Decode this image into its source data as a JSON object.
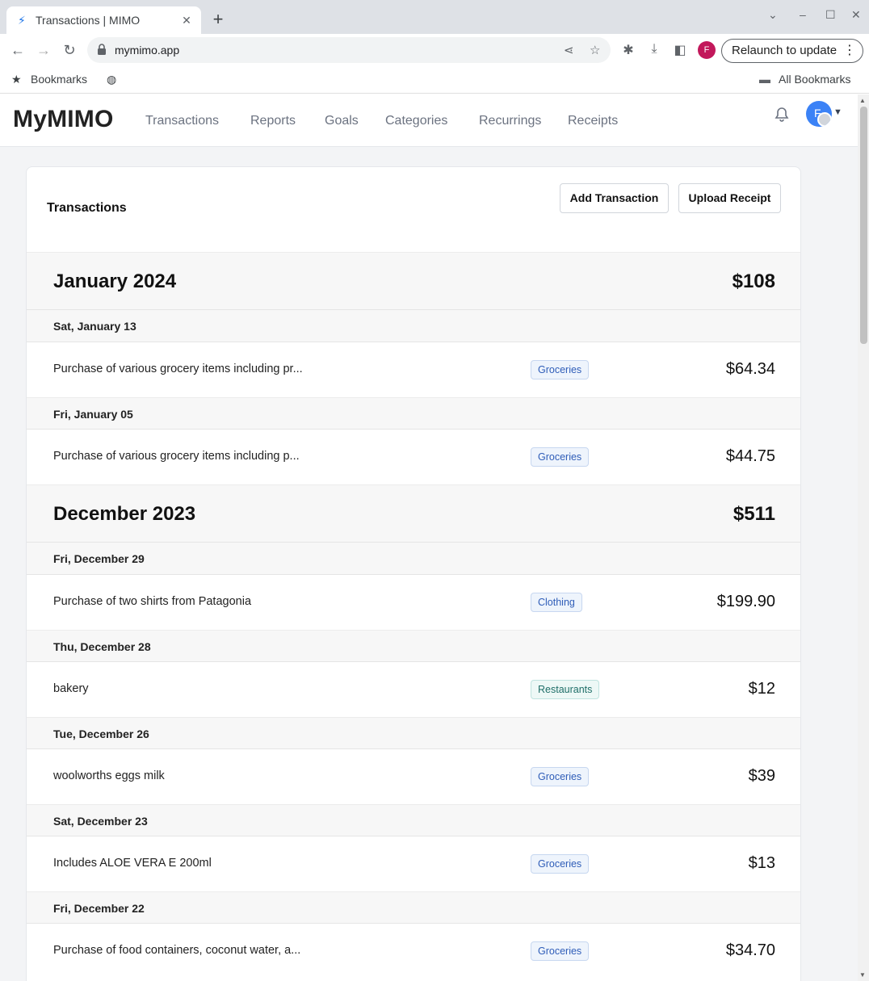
{
  "browser": {
    "tab_title": "Transactions | MIMO",
    "url": "mymimo.app",
    "relaunch_label": "Relaunch to update",
    "profile_initial": "F",
    "bookmarks_label": "Bookmarks",
    "all_bookmarks_label": "All Bookmarks"
  },
  "app": {
    "logo": "MyMIMO",
    "nav": [
      "Transactions",
      "Reports",
      "Goals",
      "Categories",
      "Recurrings",
      "Receipts"
    ],
    "avatar_initial": "F"
  },
  "card": {
    "title": "Transactions",
    "add_button": "Add Transaction",
    "upload_button": "Upload Receipt"
  },
  "months": [
    {
      "name": "January 2024",
      "total": "$108",
      "days": [
        {
          "date": "Sat, January 13",
          "transactions": [
            {
              "description": "Purchase of various grocery items including pr...",
              "category": "Groceries",
              "amount": "$64.34"
            }
          ]
        },
        {
          "date": "Fri, January 05",
          "transactions": [
            {
              "description": "Purchase of various grocery items including p...",
              "category": "Groceries",
              "amount": "$44.75"
            }
          ]
        }
      ]
    },
    {
      "name": "December 2023",
      "total": "$511",
      "days": [
        {
          "date": "Fri, December 29",
          "transactions": [
            {
              "description": "Purchase of two shirts from Patagonia",
              "category": "Clothing",
              "amount": "$199.90"
            }
          ]
        },
        {
          "date": "Thu, December 28",
          "transactions": [
            {
              "description": "bakery",
              "category": "Restaurants",
              "amount": "$12"
            }
          ]
        },
        {
          "date": "Tue, December 26",
          "transactions": [
            {
              "description": "woolworths eggs milk",
              "category": "Groceries",
              "amount": "$39"
            }
          ]
        },
        {
          "date": "Sat, December 23",
          "transactions": [
            {
              "description": "Includes ALOE VERA E 200ml",
              "category": "Groceries",
              "amount": "$13"
            }
          ]
        },
        {
          "date": "Fri, December 22",
          "transactions": [
            {
              "description": "Purchase of food containers, coconut water, a...",
              "category": "Groceries",
              "amount": "$34.70"
            }
          ]
        }
      ]
    }
  ]
}
